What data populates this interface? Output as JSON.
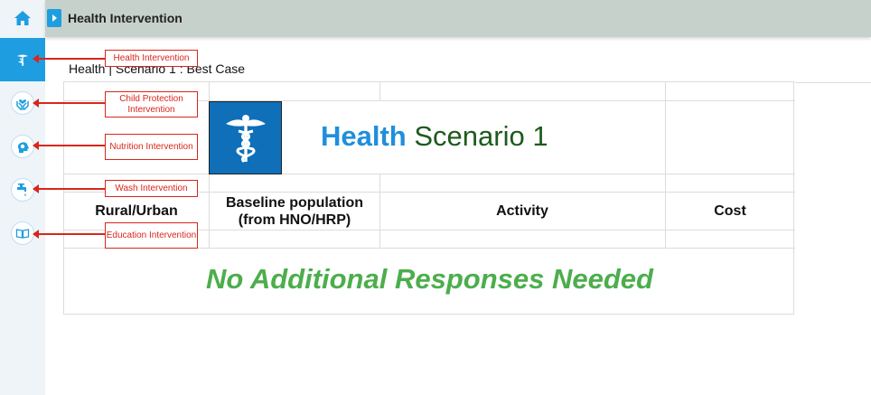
{
  "header": {
    "title": "Health Intervention"
  },
  "page": {
    "subtitle": "Health | Scenario 1 : Best Case"
  },
  "card": {
    "title_part1": "Health",
    "title_part2": "Scenario 1"
  },
  "table": {
    "columns": [
      "Rural/Urban",
      "Baseline population (from HNO/HRP)",
      "Activity",
      "Cost"
    ],
    "empty_message": "No Additional Responses Needed"
  },
  "annotations": [
    "Health Intervention",
    "Child Protection Intervention",
    "Nutrition Intervention",
    "Wash Intervention",
    "Education Intervention"
  ],
  "icons": {
    "home": "home-icon",
    "health": "caduceus-icon",
    "child_protection": "hands-heart-icon",
    "nutrition": "head-apple-icon",
    "wash": "water-tap-icon",
    "education": "open-book-icon"
  },
  "colors": {
    "accent": "#1e9ee0",
    "topbar": "#c7d1cb",
    "annotation": "#d9261c",
    "banner": "#4cae4c",
    "title_blue": "#1e8fdc",
    "title_green": "#1d5a1d"
  }
}
